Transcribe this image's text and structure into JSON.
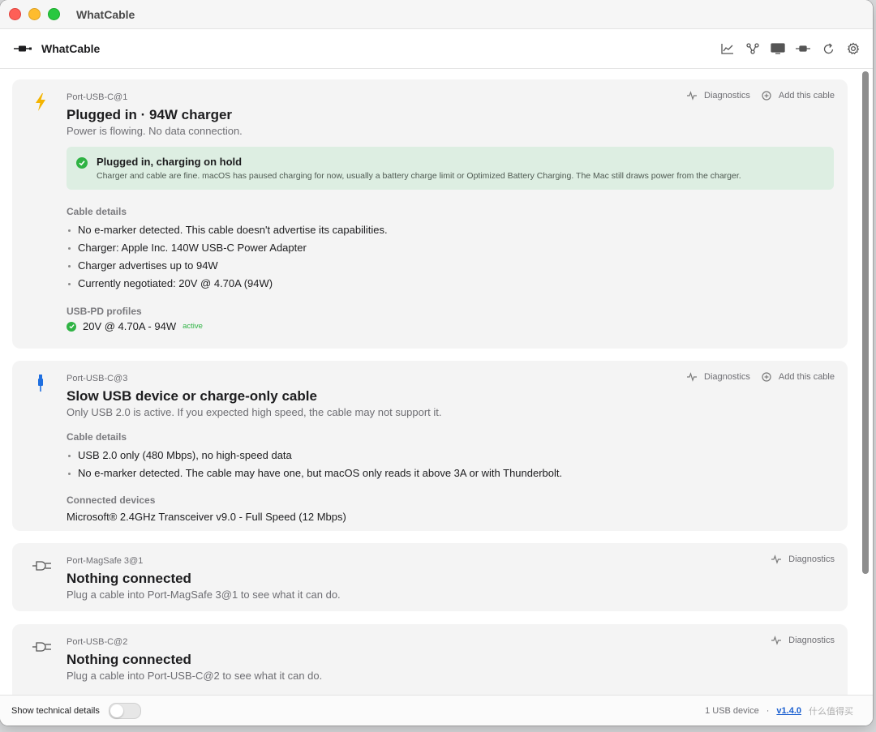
{
  "window": {
    "title": "WhatCable"
  },
  "toolbar": {
    "app_name": "WhatCable",
    "tools": [
      "chart-icon",
      "topology-icon",
      "display-icon",
      "cable-icon",
      "refresh-icon",
      "gear-icon"
    ]
  },
  "colors": {
    "accent_green": "#2fb344",
    "banner_bg": "#ddeee2",
    "card_bg": "#f4f4f4",
    "link": "#1a5fd0"
  },
  "cards": [
    {
      "port": "Port-USB-C@1",
      "icon": "lightning-icon",
      "title": "Plugged in · 94W charger",
      "subtitle": "Power is flowing. No data connection.",
      "actions": {
        "diagnostics": "Diagnostics",
        "add": "Add this cable"
      },
      "banner": {
        "title": "Plugged in, charging on hold",
        "text": "Charger and cable are fine. macOS has paused charging for now, usually a battery charge limit or Optimized Battery Charging. The Mac still draws power from the charger."
      },
      "details_label": "Cable details",
      "details": [
        "No e-marker detected. This cable doesn't advertise its capabilities.",
        "Charger: Apple Inc. 140W USB-C Power Adapter",
        "Charger advertises up to 94W",
        "Currently negotiated: 20V @ 4.70A (94W)"
      ],
      "profiles_label": "USB-PD profiles",
      "profile": {
        "text": "20V @ 4.70A - 94W",
        "status": "active"
      }
    },
    {
      "port": "Port-USB-C@3",
      "icon": "usb-icon",
      "title": "Slow USB device or charge-only cable",
      "subtitle": "Only USB 2.0 is active. If you expected high speed, the cable may not support it.",
      "actions": {
        "diagnostics": "Diagnostics",
        "add": "Add this cable"
      },
      "details_label": "Cable details",
      "details": [
        "USB 2.0 only (480 Mbps), no high-speed data",
        "No e-marker detected. The cable may have one, but macOS only reads it above 3A or with Thunderbolt."
      ],
      "devices_label": "Connected devices",
      "device": "Microsoft® 2.4GHz Transceiver v9.0 - Full Speed (12 Mbps)"
    },
    {
      "port": "Port-MagSafe 3@1",
      "icon": "plug-icon",
      "title": "Nothing connected",
      "subtitle": "Plug a cable into Port-MagSafe 3@1 to see what it can do.",
      "actions": {
        "diagnostics": "Diagnostics"
      }
    },
    {
      "port": "Port-USB-C@2",
      "icon": "plug-icon",
      "title": "Nothing connected",
      "subtitle": "Plug a cable into Port-USB-C@2 to see what it can do.",
      "actions": {
        "diagnostics": "Diagnostics"
      }
    }
  ],
  "statusbar": {
    "toggle_label": "Show technical details",
    "device_count": "1 USB device",
    "separator": "·",
    "version": "v1.4.0",
    "watermark": "什么值得买"
  }
}
